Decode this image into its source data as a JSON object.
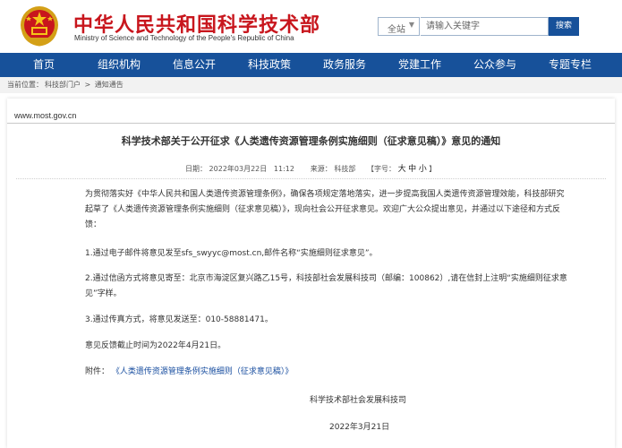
{
  "header": {
    "title": "中华人民共和国科学技术部",
    "subtitle": "Ministry of Science and Technology of the People's Republic of China",
    "search": {
      "scope": "全站",
      "placeholder": "请输入关键字",
      "button": "搜索"
    }
  },
  "nav": {
    "items": [
      "首页",
      "组织机构",
      "信息公开",
      "科技政策",
      "政务服务",
      "党建工作",
      "公众参与",
      "专题专栏"
    ]
  },
  "breadcrumb": {
    "label": "当前位置：",
    "items": [
      "科技部门户",
      "通知通告"
    ],
    "separator": ">"
  },
  "article": {
    "site_domain": "www.most.gov.cn",
    "title": "科学技术部关于公开征求《人类遗传资源管理条例实施细则（征求意见稿）》意见的通知",
    "date_label": "日期：",
    "date": "2022年03月22日",
    "time": "11:12",
    "source_label": "来源：",
    "source": "科技部",
    "font_size_label": "【字号：",
    "font_sizes": [
      "大",
      "中",
      "小"
    ],
    "font_size_close": "】",
    "paragraphs": [
      "为贯彻落实好《中华人民共和国人类遗传资源管理条例》，确保各项规定落地落实，进一步提高我国人类遗传资源管理效能，科技部研究起草了《人类遗传资源管理条例实施细则（征求意见稿）》，现向社会公开征求意见。欢迎广大公众提出意见，并通过以下途径和方式反馈：",
      "1.通过电子邮件将意见发至sfs_swyyc@most.cn,邮件名称“实施细则征求意见”。",
      "2.通过信函方式将意见寄至：北京市海淀区复兴路乙15号，科技部社会发展科技司（邮编：100862）,请在信封上注明“实施细则征求意见”字样。",
      "3.通过传真方式，将意见发送至：010-58881471。",
      "意见反馈截止时间为2022年4月21日。"
    ],
    "attachment_label": "附件：",
    "attachment_link": "《人类遗传资源管理条例实施细则（征求意见稿）》",
    "signer": "科学技术部社会发展科技司",
    "sign_date": "2022年3月21日"
  }
}
